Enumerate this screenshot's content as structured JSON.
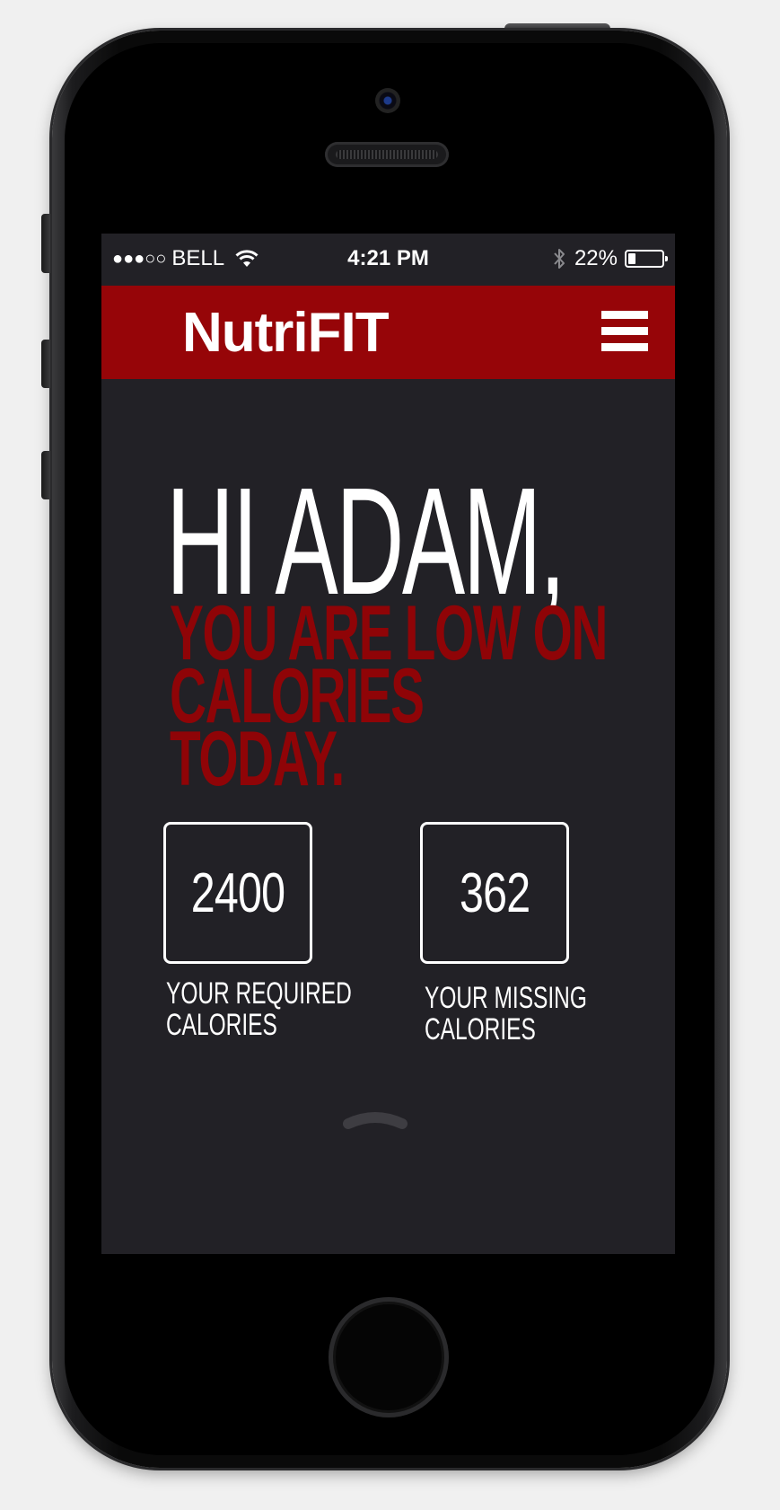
{
  "status_bar": {
    "signal": "●●●○○",
    "carrier": "BELL",
    "time": "4:21 PM",
    "battery_percent": "22%",
    "battery_level": 0.22
  },
  "nav": {
    "title": "NutriFIT"
  },
  "main": {
    "greeting": "HI ADAM,",
    "alert_lines": [
      "YOU ARE LOW ON",
      "CALORIES",
      "TODAY."
    ],
    "stats": [
      {
        "value": "2400",
        "label_lines": [
          "YOUR REQUIRED",
          "CALORIES"
        ]
      },
      {
        "value": "362",
        "label_lines": [
          "YOUR MISSING",
          "CALORIES"
        ]
      }
    ]
  },
  "colors": {
    "brand_red": "#960508",
    "alert_red": "#8f0407",
    "screen_bg": "#222126"
  },
  "icons": {
    "menu": "hamburger-menu-icon",
    "wifi": "wifi-icon",
    "bluetooth": "bluetooth-icon",
    "battery": "battery-icon",
    "pull_up": "chevron-up-icon"
  }
}
